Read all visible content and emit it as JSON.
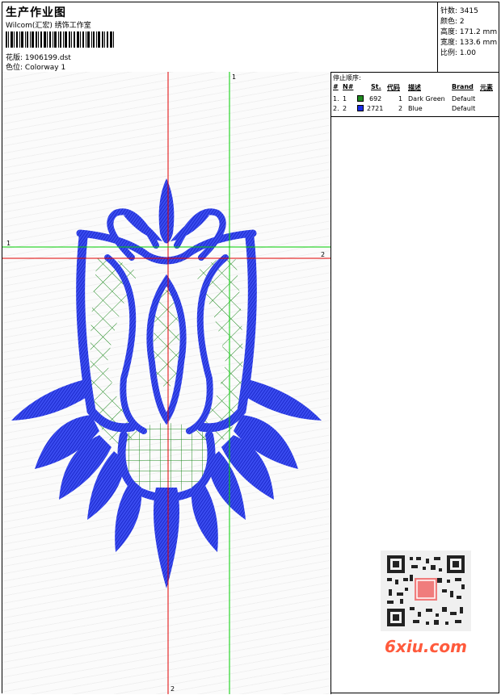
{
  "header": {
    "title": "生产作业图",
    "company": "Wilcom(汇宏) 绣饰工作室",
    "design_label": "花版:",
    "design_value": "1906199.dst",
    "colorway_label": "色位:",
    "colorway_value": "Colorway 1"
  },
  "stats": {
    "stitches_label": "针数:",
    "stitches": "3415",
    "colors_label": "颜色:",
    "colors": "2",
    "height_label": "高度:",
    "height": "171.2 mm",
    "width_label": "宽度:",
    "width": "133.6 mm",
    "scale_label": "比例:",
    "scale": "1.00"
  },
  "stop_sequence": {
    "title": "停止顺序:",
    "columns": [
      "#",
      "N#",
      "St.",
      "代码",
      "描述",
      "Brand",
      "元素"
    ],
    "rows": [
      {
        "index": "1.",
        "needle": "1",
        "color": "#1f8a1f",
        "stitches": "692",
        "code": "1",
        "desc": "Dark Green",
        "brand": "Default"
      },
      {
        "index": "2.",
        "needle": "2",
        "color": "#1a2de6",
        "stitches": "2721",
        "code": "2",
        "desc": "Blue",
        "brand": "Default"
      }
    ]
  },
  "guides": {
    "red_label": "2",
    "green_label": "1"
  },
  "watermark": {
    "text": "6xiu.com"
  },
  "colors": {
    "guide_red": "#e00000",
    "guide_green": "#00cc00",
    "thread_blue": "#1a2de6",
    "thread_green": "#1f8a1f"
  }
}
